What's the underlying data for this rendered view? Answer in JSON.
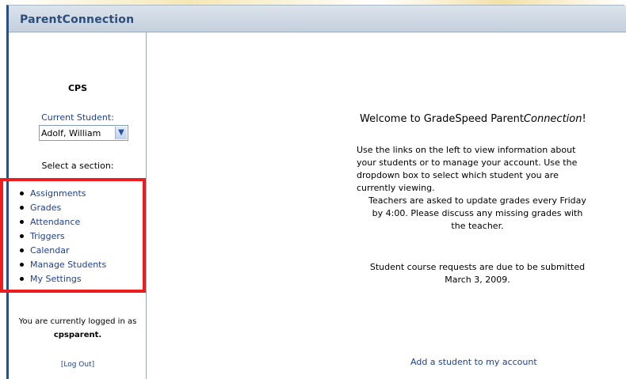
{
  "header": {
    "app_title": "ParentConnection"
  },
  "sidebar": {
    "district": "CPS",
    "current_student_label": "Current Student:",
    "student_select_value": "Adolf, William",
    "select_section_label": "Select a section:",
    "nav_items": [
      {
        "label": "Assignments"
      },
      {
        "label": "Grades"
      },
      {
        "label": "Attendance"
      },
      {
        "label": "Triggers"
      },
      {
        "label": "Calendar"
      },
      {
        "label": "Manage Students"
      },
      {
        "label": "My Settings"
      }
    ],
    "logged_in_text": "You are currently logged in as",
    "username": "cpsparent.",
    "logout_label": "[Log Out]"
  },
  "main": {
    "welcome_prefix": "Welcome to GradeSpeed Parent",
    "welcome_italic": "Connection",
    "welcome_suffix": "!",
    "intro_lines": [
      "Use the links on the left to view information about",
      "your students or to manage your account.   Use the",
      "dropdown box to select which student you are",
      "currently viewing."
    ],
    "teacher_lines": [
      "Teachers are asked to update grades every Friday",
      "by 4:00. Please discuss any missing grades with",
      "the teacher."
    ],
    "course_lines": [
      "Student course requests are due to be submitted",
      "March 3, 2009."
    ],
    "add_student_link": "Add a student to my account"
  },
  "colors": {
    "link": "#1f3f8f",
    "header_text": "#2d4e7a",
    "highlight_border": "#ee1c1c",
    "left_border": "#2a4f86"
  }
}
